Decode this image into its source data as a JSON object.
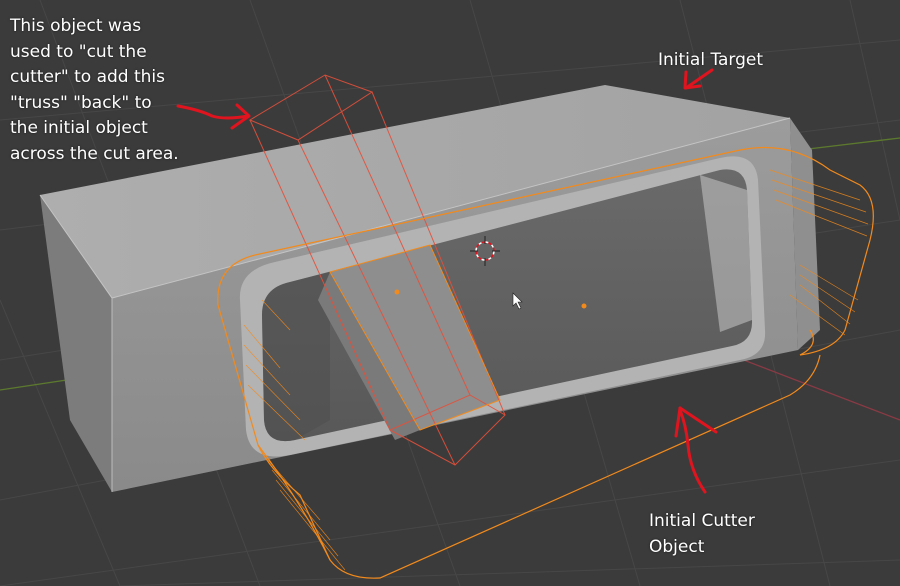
{
  "annotations": {
    "truss_note": "This object was\nused to \"cut the\ncutter\" to add this\n\"truss\" \"back\" to\nthe initial object\nacross the cut area.",
    "initial_target": "Initial Target",
    "initial_cutter": "Initial Cutter\nObject"
  },
  "colors": {
    "viewport_bg": "#3b3b3b",
    "grid_line": "#474747",
    "x_axis": "#8a3a44",
    "y_axis": "#5c7a2e",
    "mesh_light": "#a9a9a9",
    "mesh_dark": "#6e6e6e",
    "cutter_wire": "#f28a1c",
    "truss_wire": "#e4503a",
    "annotation_arrow": "#e0141e",
    "annotation_text": "#ffffff"
  },
  "icons": {
    "cursor": "3d-cursor-icon",
    "mouse": "mouse-pointer-icon"
  }
}
